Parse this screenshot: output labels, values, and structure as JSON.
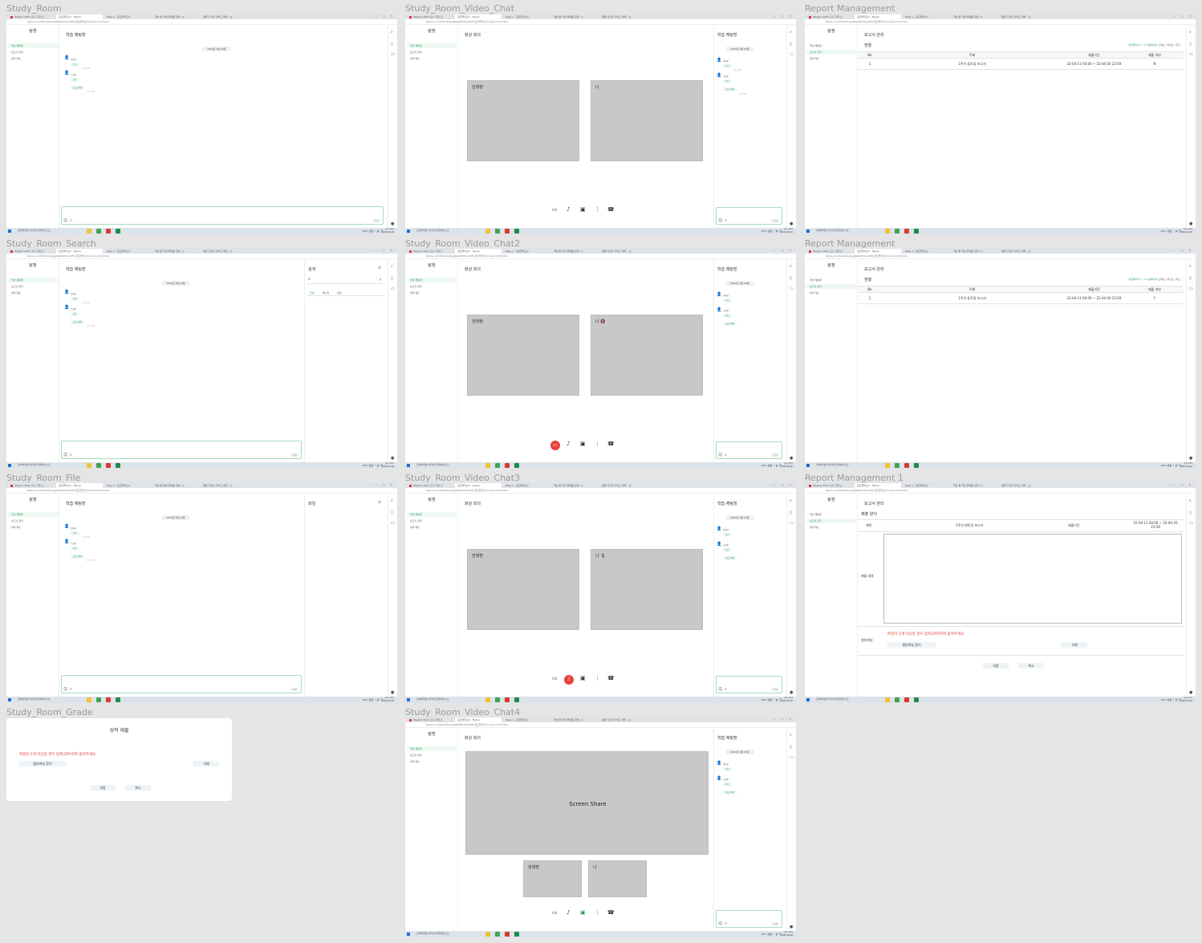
{
  "frames": {
    "f1": {
      "title": "Study_Room"
    },
    "f2": {
      "title": "Study_Room_Video_Chat"
    },
    "f3": {
      "title": "Report Management"
    },
    "f4": {
      "title": "Study_Room_Search"
    },
    "f5": {
      "title": "Study_Room_Video_Chat2"
    },
    "f6": {
      "title": "Report Management"
    },
    "f7": {
      "title": "Study_Room_File"
    },
    "f8": {
      "title": "Study_Room_Video_Chat3"
    },
    "f9": {
      "title": "Report Management 1"
    },
    "f10": {
      "title": "Study_Room_Grade"
    },
    "f11": {
      "title": "Study_Room_Video_Chat4"
    }
  },
  "browser": {
    "tabs": [
      "Waybar 2022 출시 기업 소",
      "포트폴리오2 - Figma",
      "Page 1 - 포트폴리오2",
      "학습 툴 학습 플랫폼 관련 | 2..",
      "컴퓨 디자인 가이드 제작 - 소.."
    ],
    "url": "figma.com/file/kVbxSygNeWWmlsvXZFl/포트폴리오2?node-id=0%3A1",
    "window_controls": "— ▢ ✕"
  },
  "sidebar": {
    "logo": "탐쟁",
    "items": [
      "학습 채팅방",
      "보고서 관리",
      "성적 제출"
    ]
  },
  "chat": {
    "title": "학습 채팅방",
    "date_f1": "2022년 4월 20일",
    "date": "2022년 4월 20일",
    "user1": "김태현",
    "user2": "구성원",
    "msg1": "안녕",
    "msg2": "안녕",
    "msg3": "오늘 뭐해?",
    "time": "오후 3:00",
    "send": "전송"
  },
  "video": {
    "title": "화상 회의",
    "tile1": "안대현",
    "tile2": "나",
    "tile2_muted": "나 🔇",
    "tile2_speaking": "나 🎙",
    "screen_share": "Screen Share"
  },
  "search": {
    "panel_title": "검색",
    "tabs": [
      "전체",
      "메시지",
      "파일"
    ]
  },
  "file": {
    "panel_title": "파일"
  },
  "report": {
    "page_title": "보고서 관리",
    "section": "현황",
    "pager": "이전페이지",
    "pager_pages": "1 / 1",
    "pager_next": "다음페이지",
    "sort": "오래순 | 최신순 | 최고",
    "headers": [
      "No",
      "주제",
      "제출기간",
      "제출 여부"
    ],
    "row": {
      "no": "1",
      "topic": "1주차 튜토링 보고서",
      "period": "22-04-11 00:00 ~ 22-04-20 23:59",
      "status_n": "N",
      "status_y": "Y"
    }
  },
  "report_submit": {
    "section": "제출 양식",
    "title_label": "제목",
    "title_value": "1주차 멘토링 보고서",
    "period_label": "제출기간",
    "period_value": "22-04-11 00:00 ~ 22-04-20 23:59",
    "content_label": "제출 내용",
    "attach_label": "첨부파일",
    "warning": "파일이 2개 이상일 경우 압축(ZIP)하여 올려주세요.",
    "find_button": "첨부파일 찾기",
    "delete_button": "삭제",
    "save_button": "저장",
    "cancel_button": "취소"
  },
  "grade": {
    "title": "성적 제출",
    "warning": "파일이 2개 이상일 경우 압축(ZIP)하여 올려주세요.",
    "find_button": "첨부파일 찾기",
    "delete_button": "삭제",
    "save_button": "저장",
    "cancel_button": "취소"
  },
  "taskbar": {
    "search": "검색하려면 여기에 입력하십시오.",
    "tray": "14°C 흐림  ^ 🔊 한",
    "clock": "오후 3:47",
    "date": "2022-04-20"
  },
  "colors": {
    "accent": "#2e9d56",
    "warning": "#e03a2f",
    "tile": "#c8c8c8",
    "input_border": "#a6dcbd"
  },
  "icons": [
    "search-icon",
    "file-icon",
    "video-icon",
    "profile-icon",
    "emoji-icon",
    "attach-icon",
    "camera-icon",
    "mic-icon",
    "screen-share-icon",
    "more-icon",
    "hangup-icon",
    "close-icon"
  ]
}
